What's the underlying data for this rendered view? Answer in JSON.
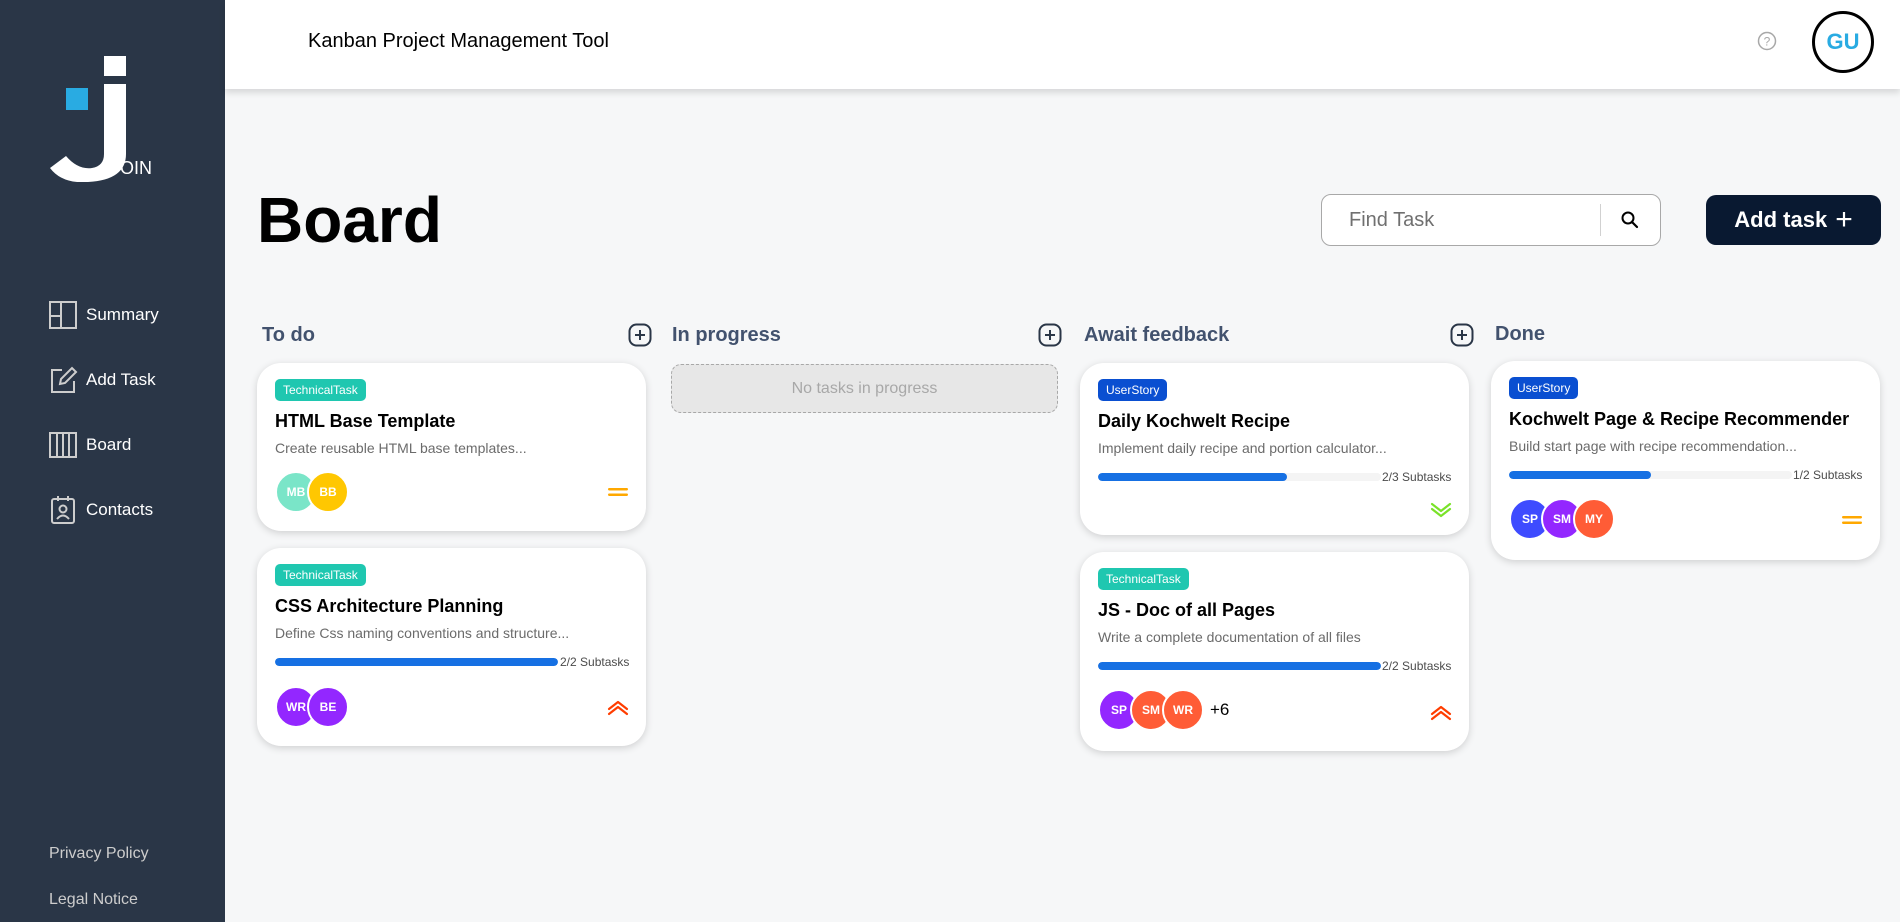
{
  "app": {
    "logo_text": "OIN",
    "header_title": "Kanban Project Management Tool",
    "user_initials": "GU"
  },
  "sidebar": {
    "items": [
      {
        "label": "Summary",
        "icon": "summary-icon"
      },
      {
        "label": "Add Task",
        "icon": "add-task-icon"
      },
      {
        "label": "Board",
        "icon": "board-icon"
      },
      {
        "label": "Contacts",
        "icon": "contacts-icon"
      }
    ],
    "footer": {
      "privacy": "Privacy Policy",
      "legal": "Legal Notice"
    }
  },
  "board": {
    "title": "Board",
    "search_placeholder": "Find Task",
    "add_task_label": "Add task",
    "add_task_plus": "+"
  },
  "columns": {
    "todo": {
      "title": "To do"
    },
    "progress": {
      "title": "In progress",
      "empty_text": "No tasks in progress"
    },
    "feedback": {
      "title": "Await feedback"
    },
    "done": {
      "title": "Done"
    }
  },
  "cards": {
    "c1": {
      "category": "TechnicalTask",
      "title": "HTML Base Template",
      "description": "Create reusable HTML base templates...",
      "assignees": [
        {
          "initials": "MB",
          "color": "#7ae5c8"
        },
        {
          "initials": "BB",
          "color": "#ffc701"
        }
      ],
      "priority": "medium"
    },
    "c2": {
      "category": "TechnicalTask",
      "title": "CSS Architecture Planning",
      "description": "Define Css naming conventions and structure...",
      "subtasks": "2/2 Subtasks",
      "progress": 1.0,
      "assignees": [
        {
          "initials": "WR",
          "color": "#9327ff"
        },
        {
          "initials": "BE",
          "color": "#9327ff"
        }
      ],
      "priority": "urgent"
    },
    "c3": {
      "category": "UserStory",
      "title": "Daily Kochwelt Recipe",
      "description": "Implement daily recipe and portion calculator...",
      "subtasks": "2/3 Subtasks",
      "progress": 0.667,
      "priority": "low"
    },
    "c4": {
      "category": "TechnicalTask",
      "title": "JS - Doc of all Pages",
      "description": "Write a complete documentation of all files",
      "subtasks": "2/2 Subtasks",
      "progress": 1.0,
      "assignees": [
        {
          "initials": "SP",
          "color": "#9327ff"
        },
        {
          "initials": "SM",
          "color": "#ff5c36"
        },
        {
          "initials": "WR",
          "color": "#ff5c36"
        }
      ],
      "more": "+6",
      "priority": "urgent"
    },
    "c5": {
      "category": "UserStory",
      "title": "Kochwelt Page & Recipe Recommender",
      "description": "Build start page with recipe recommendation...",
      "subtasks": "1/2 Subtasks",
      "progress": 0.5,
      "assignees": [
        {
          "initials": "SP",
          "color": "#3e4bff"
        },
        {
          "initials": "SM",
          "color": "#9327ff"
        },
        {
          "initials": "MY",
          "color": "#ff5c36"
        }
      ],
      "priority": "medium"
    }
  },
  "colors": {
    "sidebar": "#2a3647",
    "accent": "#29abe2",
    "primary_button": "#091931",
    "tech_tag": "#1fc7b0",
    "story_tag": "#0a4fd1",
    "progress": "#1670e3",
    "urgent": "#ff3d00",
    "medium": "#ffa800",
    "low": "#7ae229"
  }
}
